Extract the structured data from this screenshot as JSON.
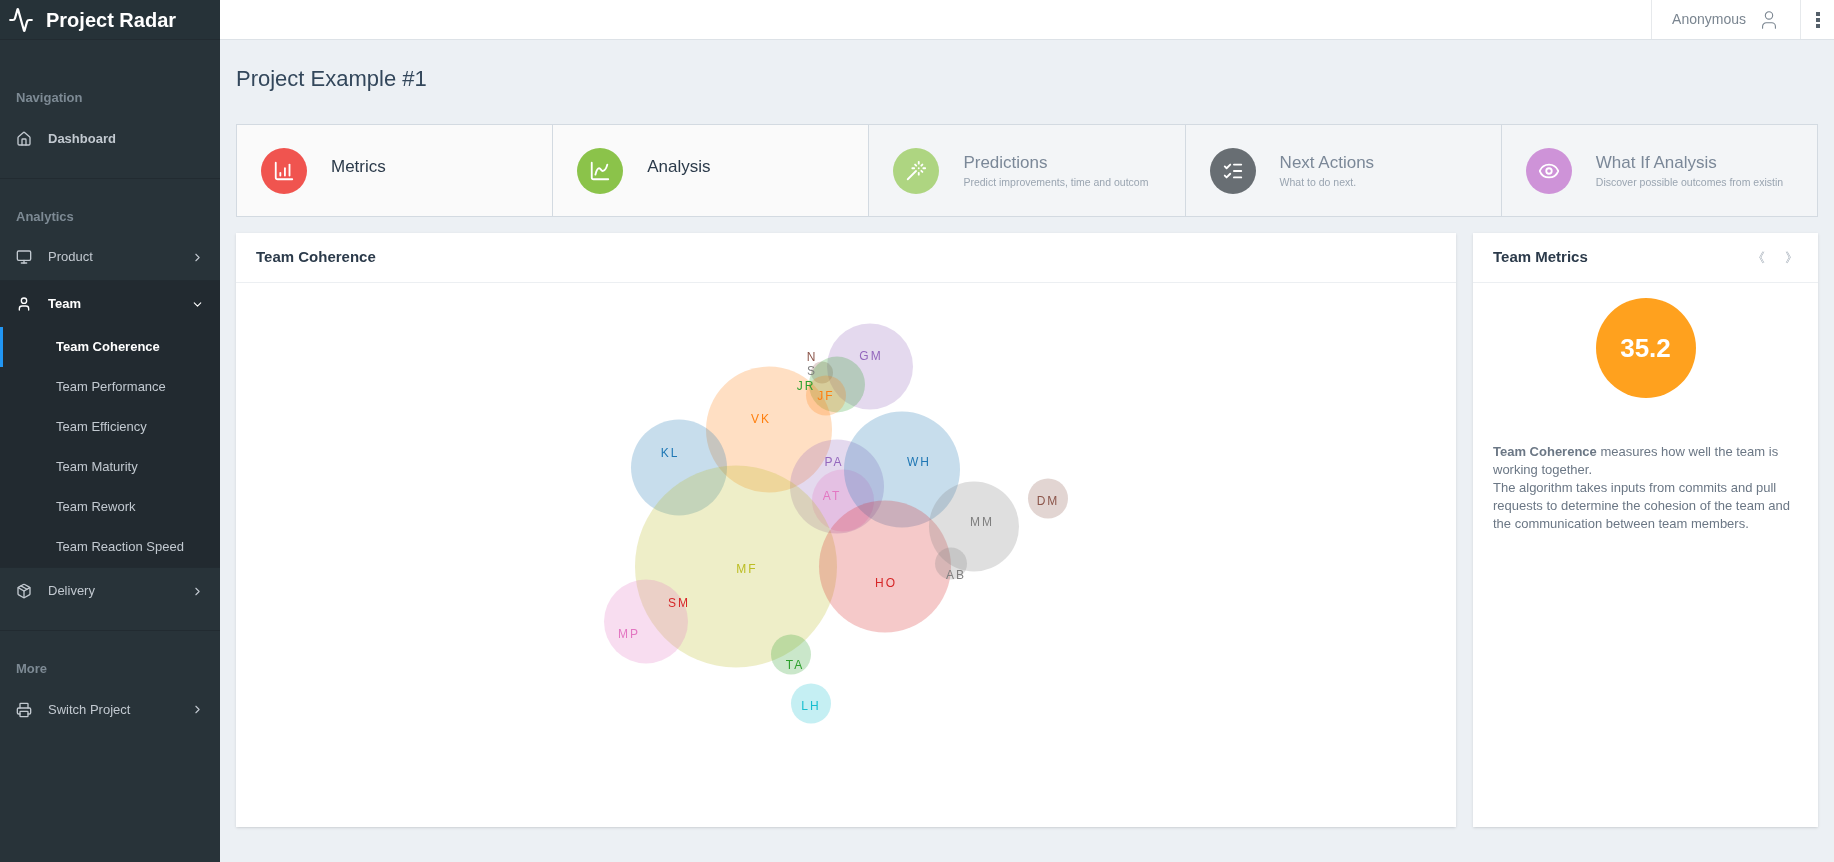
{
  "app": {
    "title": "Project Radar"
  },
  "user": {
    "name": "Anonymous"
  },
  "sidebar": {
    "sections": [
      {
        "heading": "Navigation",
        "items": [
          {
            "label": "Dashboard",
            "kind": "link"
          }
        ]
      },
      {
        "heading": "Analytics",
        "items": [
          {
            "label": "Product",
            "kind": "group",
            "expanded": false
          },
          {
            "label": "Team",
            "kind": "group",
            "expanded": true,
            "children": [
              {
                "label": "Team Coherence",
                "selected": true
              },
              {
                "label": "Team Performance",
                "selected": false
              },
              {
                "label": "Team Efficiency",
                "selected": false
              },
              {
                "label": "Team Maturity",
                "selected": false
              },
              {
                "label": "Team Rework",
                "selected": false
              },
              {
                "label": "Team Reaction Speed",
                "selected": false
              }
            ]
          },
          {
            "label": "Delivery",
            "kind": "group",
            "expanded": false
          }
        ]
      },
      {
        "heading": "More",
        "items": [
          {
            "label": "Switch Project",
            "kind": "group",
            "expanded": false
          }
        ]
      }
    ]
  },
  "page_title": "Project Example #1",
  "cards": [
    {
      "title": "Metrics",
      "disabled": false,
      "color": "#f0544f"
    },
    {
      "title": "Analysis",
      "disabled": false,
      "color": "#8bc34a"
    },
    {
      "title": "Predictions",
      "subtitle": "Predict improvements, time and outcom",
      "disabled": true,
      "color": "#aed581"
    },
    {
      "title": "Next Actions",
      "subtitle": "What to do next.",
      "disabled": true,
      "color": "#686e73"
    },
    {
      "title": "What If Analysis",
      "subtitle": "Discover possible outcomes from existin",
      "disabled": true,
      "color": "#ce93d8"
    }
  ],
  "coherence_panel": {
    "title": "Team Coherence",
    "bubbles": [
      {
        "label": "GM",
        "color": "#9467bd"
      },
      {
        "label": "N",
        "color": "#8c564b"
      },
      {
        "label": "S",
        "color": "#7f7f7f"
      },
      {
        "label": "JR",
        "color": "#2ca02c"
      },
      {
        "label": "JF",
        "color": "#ff7f0e"
      },
      {
        "label": "VK",
        "color": "#ff7f0e"
      },
      {
        "label": "KL",
        "color": "#1f77b4"
      },
      {
        "label": "PA",
        "color": "#9467bd"
      },
      {
        "label": "AT",
        "color": "#e377c2"
      },
      {
        "label": "WH",
        "color": "#1f77b4"
      },
      {
        "label": "MF",
        "color": "#bcbd22"
      },
      {
        "label": "HO",
        "color": "#d62728"
      },
      {
        "label": "MM",
        "color": "#7f7f7f"
      },
      {
        "label": "AB",
        "color": "#7f7f7f"
      },
      {
        "label": "DM",
        "color": "#8c564b"
      },
      {
        "label": "MP",
        "color": "#e377c2"
      },
      {
        "label": "SM",
        "color": "#d62728"
      },
      {
        "label": "TA",
        "color": "#2ca02c"
      },
      {
        "label": "LH",
        "color": "#17becf"
      }
    ]
  },
  "metrics_panel": {
    "title": "Team Metrics",
    "prev": "《",
    "next": "》",
    "score": "35.2",
    "paragraphs": [
      "**Team Coherence** measures how well the team is working together.",
      "The algorithm takes inputs from commits and pull requests to determine the cohesion of the team and the communication between team members."
    ]
  }
}
